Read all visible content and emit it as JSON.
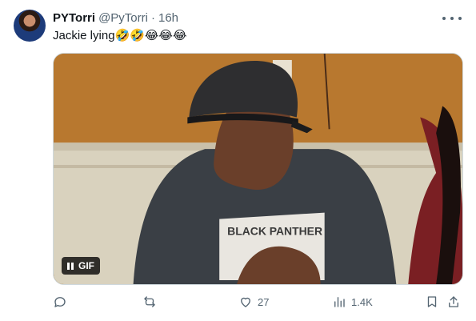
{
  "tweet": {
    "display_name": "PYTorri",
    "handle": "@PyTorri",
    "separator": "·",
    "time": "16h",
    "text": "Jackie lying🤣🤣😂😂😂"
  },
  "media": {
    "badge_label": "GIF",
    "shirt_text": "BLACK PANTHER"
  },
  "actions": {
    "reply_count": "",
    "retweet_count": "",
    "like_count": "27",
    "views_count": "1.4K"
  },
  "icons": {
    "more": "more-horizontal-icon",
    "reply": "reply-icon",
    "retweet": "retweet-icon",
    "like": "heart-icon",
    "views": "bar-chart-icon",
    "bookmark": "bookmark-icon",
    "share": "share-icon",
    "pause": "pause-icon"
  },
  "colors": {
    "text": "#0f1419",
    "muted": "#536471",
    "border": "#cfd9de"
  }
}
